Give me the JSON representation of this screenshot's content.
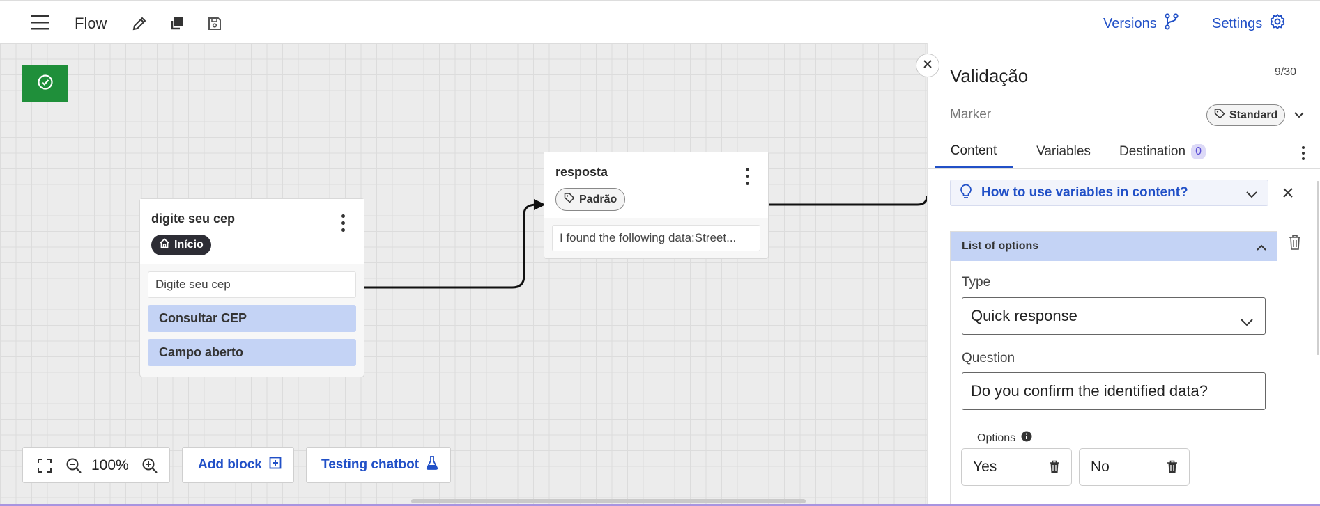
{
  "topbar": {
    "title": "Flow",
    "icons": [
      "menu-icon",
      "pencil-icon",
      "duplicate-icon",
      "save-icon"
    ],
    "versions_label": "Versions",
    "settings_label": "Settings"
  },
  "canvas": {
    "blocks": [
      {
        "title": "digite seu cep",
        "tag": "Início",
        "message": "Digite seu cep",
        "options": [
          "Consultar CEP",
          "Campo aberto"
        ]
      },
      {
        "title": "resposta",
        "tag": "Padrão",
        "message": "I found the following data:Street..."
      }
    ],
    "zoom": "100%",
    "add_block_label": "Add block",
    "testing_label": "Testing chatbot"
  },
  "panel": {
    "title": "Validação",
    "counter": "9/30",
    "marker_label": "Marker",
    "marker_value": "Standard",
    "tabs": [
      {
        "label": "Content"
      },
      {
        "label": "Variables"
      },
      {
        "label": "Destination",
        "badge": "0"
      }
    ],
    "help_text": "How to use variables in content?",
    "section_title": "List of options",
    "type_label": "Type",
    "type_value": "Quick response",
    "question_label": "Question",
    "question_value": "Do you confirm the identified data?",
    "options_label": "Options",
    "options": [
      "Yes",
      "No"
    ]
  },
  "colors": {
    "accent": "#2150c7",
    "success": "#1f8f3a",
    "option_bg": "#c4d3f5"
  }
}
